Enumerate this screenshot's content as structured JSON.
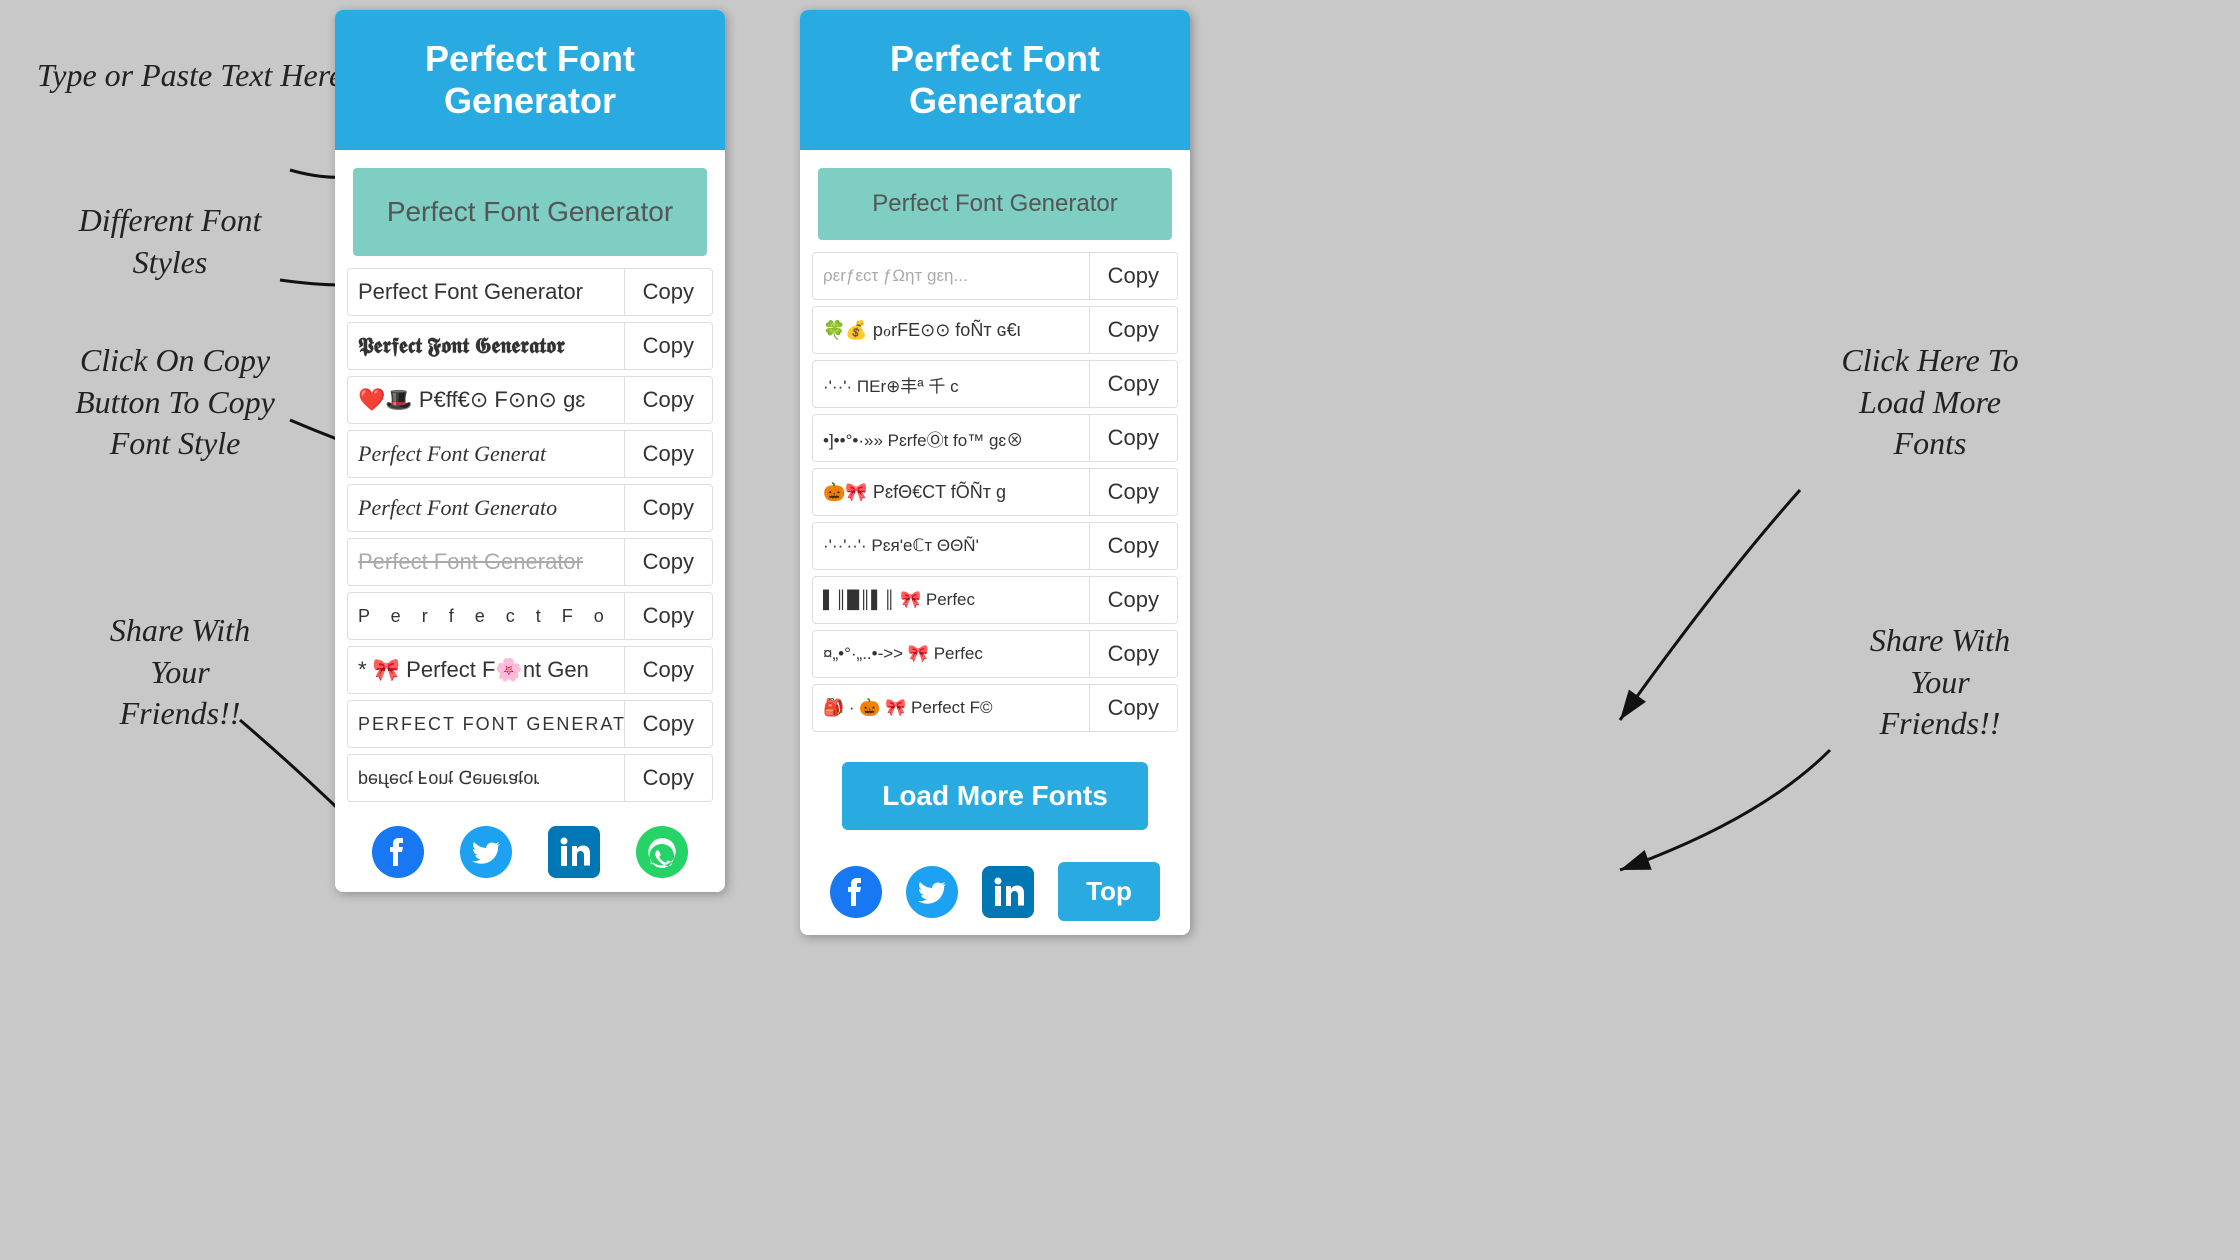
{
  "title": "Perfect Font Generator",
  "header": "Perfect Font Generator",
  "input_placeholder": "Perfect Font Generator",
  "copy_label": "Copy",
  "load_more_label": "Load More Fonts",
  "top_label": "Top",
  "annotations": {
    "type_paste": "Type or Paste Text\nHere",
    "different_fonts": "Different Font\nStyles",
    "click_copy": "Click On Copy\nButton To Copy\nFont Style",
    "share": "Share With\nYour\nFriends!!",
    "click_load": "Click Here To\nLoad More\nFonts",
    "share_right": "Share With\nYour\nFriends!!"
  },
  "left_fonts": [
    {
      "text": "Perfect Font Generator",
      "style": "normal"
    },
    {
      "text": "𝕻𝖊𝖗𝖋𝖊𝖈𝖙 𝕱𝖔𝖓𝖙 𝕲𝖊𝖓𝖊𝖗𝖆𝖙𝖔𝖗",
      "style": "fraktur"
    },
    {
      "text": "❤️🎩 P€ff€⊙ F⊙n⊙ gɛ",
      "style": "emoji"
    },
    {
      "text": "Perfect Font Generat",
      "style": "italic"
    },
    {
      "text": "Perfect Font Generato",
      "style": "italic2"
    },
    {
      "text": "Perfect Font Generator",
      "style": "strikethrough"
    },
    {
      "text": "P e r f e c t  F o n t",
      "style": "spaced"
    },
    {
      "text": "* 🎀 Perfect Font Gen",
      "style": "emoji2"
    },
    {
      "text": "PERFECT FONT GENERATOR",
      "style": "caps"
    },
    {
      "text": "ɹoʇɐɹǝuǝ⅁ ʇuoℲ ʇɔǝɟɹǝd",
      "style": "flipped"
    }
  ],
  "right_fonts": [
    {
      "text": "ρεrƒεcτ ƒΩηт gεη"
    },
    {
      "text": "🍀💰 pℴrFE⊙⊙ foÑт ɢ€ι"
    },
    {
      "text": "·'··'· ΠΕr⊕丰ª 千 c"
    },
    {
      "text": "•]••°•·»» PɛrfeⓄt fo™ gɛ⊗"
    },
    {
      "text": "🎃🎀 PɛfΘ€CT fÕÑт g"
    },
    {
      "text": "·'··'··'· Pɛя'eℂт ΘΘÑ'"
    },
    {
      "text": "▌║█║▌║ 🎀 Perfec"
    },
    {
      "text": "¤„•°·„..•->> 🎀 Perfec"
    },
    {
      "text": "🎒 · 🎃 🎀 Perfect F©"
    }
  ],
  "social_icons": [
    "facebook",
    "twitter",
    "linkedin",
    "whatsapp"
  ]
}
